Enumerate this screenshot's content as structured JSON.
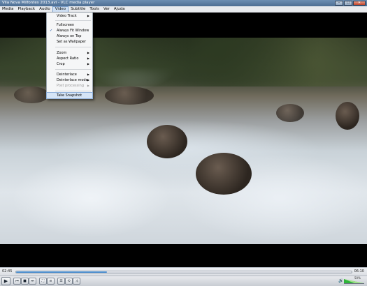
{
  "window": {
    "title": "Vila Nova Milfontes 2013.avi - VLC media player",
    "buttons": {
      "minimize": "–",
      "maximize": "□",
      "close": "✕"
    }
  },
  "menubar": {
    "items": [
      "Media",
      "Playback",
      "Audio",
      "Video",
      "Subtitle",
      "Tools",
      "Ver",
      "Ajuda"
    ],
    "active": "Video"
  },
  "video_menu": {
    "items": [
      {
        "label": "Video Track",
        "submenu": true
      },
      {
        "label": "Fullscreen"
      },
      {
        "label": "Always Fit Window",
        "checked": true
      },
      {
        "label": "Always on Top"
      },
      {
        "label": "Set as Wallpaper"
      },
      {
        "label": "Zoom",
        "submenu": true
      },
      {
        "label": "Aspect Ratio",
        "submenu": true
      },
      {
        "label": "Crop",
        "submenu": true
      },
      {
        "label": "Deinterlace",
        "submenu": true
      },
      {
        "label": "Deinterlace mode",
        "submenu": true
      },
      {
        "label": "Post processing",
        "submenu": true,
        "disabled": true
      },
      {
        "label": "Take Snapshot",
        "hover": true
      }
    ],
    "check_glyph": "✓",
    "submenu_glyph": "▶"
  },
  "player": {
    "elapsed": "02:45",
    "total": "06:10",
    "progress": 0.27,
    "volume_percent": 50,
    "volume_label": "50%"
  },
  "controls": {
    "play": "▶",
    "prev": "⏮",
    "stop": "■",
    "next": "⏭",
    "fullscreen": "⛶",
    "extended": "≡",
    "playlist": "☰",
    "loop": "⟲",
    "random": "⤨",
    "volume_icon": "🔊"
  }
}
